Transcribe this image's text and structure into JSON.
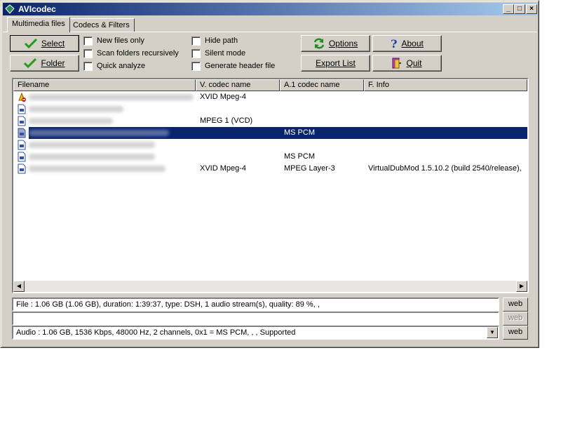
{
  "window": {
    "title": "AVIcodec"
  },
  "title_buttons": {
    "minimize": "_",
    "maximize": "□",
    "close": "×"
  },
  "tabs": [
    {
      "label": "Multimedia files"
    },
    {
      "label": "Codecs & Filters"
    }
  ],
  "buttons": {
    "select": "Select",
    "folder": "Folder",
    "options": "Options",
    "about": "About",
    "export": "Export List",
    "quit": "Quit"
  },
  "checkboxes": [
    {
      "label": "New files only",
      "checked": false
    },
    {
      "label": "Scan folders recursively",
      "checked": false
    },
    {
      "label": "Quick analyze",
      "checked": false
    },
    {
      "label": "Hide path",
      "checked": false
    },
    {
      "label": "Silent mode",
      "checked": false
    },
    {
      "label": "Generate header file",
      "checked": false
    }
  ],
  "list": {
    "columns": [
      "Filename",
      "V. codec name",
      "A.1 codec name",
      "F. Info"
    ],
    "rows": [
      {
        "icon": "warning-file-icon",
        "vcodec": "XVID Mpeg-4",
        "acodec": "",
        "info": "",
        "selected": false
      },
      {
        "icon": "video-file-icon",
        "vcodec": "",
        "acodec": "",
        "info": "",
        "selected": false
      },
      {
        "icon": "video-file-icon",
        "vcodec": "MPEG 1 (VCD)",
        "acodec": "",
        "info": "",
        "selected": false
      },
      {
        "icon": "video-file-icon",
        "vcodec": "",
        "acodec": "MS PCM",
        "info": "",
        "selected": true
      },
      {
        "icon": "video-file-icon",
        "vcodec": "",
        "acodec": "",
        "info": "",
        "selected": false
      },
      {
        "icon": "video-file-icon",
        "vcodec": "",
        "acodec": "MS PCM",
        "info": "",
        "selected": false
      },
      {
        "icon": "video-file-icon",
        "vcodec": "XVID Mpeg-4",
        "acodec": "MPEG Layer-3",
        "info": "VirtualDubMod 1.5.10.2 (build 2540/release),",
        "selected": false
      }
    ]
  },
  "status": {
    "file": "File    :  1.06 GB (1.06 GB),  duration: 1:39:37,  type: DSH,  1 audio stream(s),  quality: 89 %, ,",
    "video": "",
    "audio": "Audio :  1.06 GB,  1536 Kbps,  48000 Hz,  2 channels,  0x1 = MS PCM,  , ,   Supported"
  },
  "web_label": "web",
  "colors": {
    "selection": "#0a246a",
    "titlebar_start": "#0a246a",
    "titlebar_end": "#a6caf0",
    "check_green": "#2a9a1a"
  }
}
